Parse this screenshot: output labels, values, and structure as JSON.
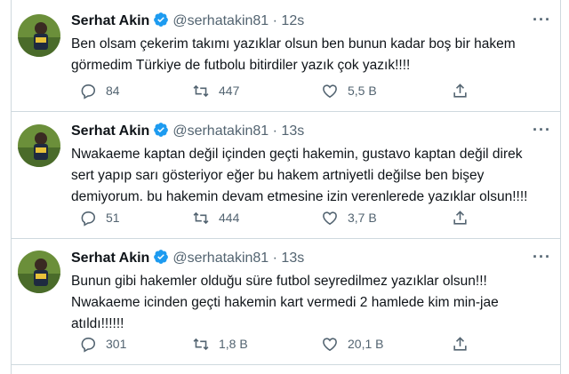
{
  "tweets": [
    {
      "name": "Serhat Akin",
      "handle": "@serhatakin81",
      "time": "· 12s",
      "text": "Ben olsam çekerim takımı yazıklar olsun ben bunun kadar boş bir hakem görmedim Türkiye de futbolu bitirdiler yazık çok yazık!!!!",
      "lines": [
        "Ben olsam çekerim takımı yazıklar olsun ben bunun kadar boş bir hakem",
        "görmedim Türkiye de futbolu bitirdiler yazık çok yazık!!!!"
      ],
      "replies": "84",
      "retweets": "447",
      "likes": "5,5 B"
    },
    {
      "name": "Serhat Akin",
      "handle": "@serhatakin81",
      "time": "· 13s",
      "lines": [
        "Nwakaeme kaptan değil içinden geçti hakemin, gustavo kaptan değil direk",
        "sert yapıp sarı gösteriyor eğer bu hakem artniyetli değilse ben bişey",
        "demiyorum. bu hakemin devam etmesine izin verenlerede yazıklar olsun!!!!"
      ],
      "replies": "51",
      "retweets": "444",
      "likes": "3,7 B"
    },
    {
      "name": "Serhat Akin",
      "handle": "@serhatakin81",
      "time": "· 13s",
      "lines": [
        "Bunun gibi hakemler olduğu süre futbol seyredilmez yazıklar olsun!!!",
        "Nwakaeme icinden geçti hakemin kart vermedi 2 hamlede kim min-jae",
        "atıldı!!!!!!"
      ],
      "replies": "301",
      "retweets": "1,8 B",
      "likes": "20,1 B"
    }
  ],
  "icons": {
    "more": "more-dots-icon",
    "reply": "reply-icon",
    "retweet": "retweet-icon",
    "like": "like-icon",
    "share": "share-icon",
    "verified": "verified-badge-icon"
  },
  "colors": {
    "verified": "#1d9bf0",
    "text": "#0f1419",
    "secondary": "#536471",
    "border": "#cfd9de"
  }
}
